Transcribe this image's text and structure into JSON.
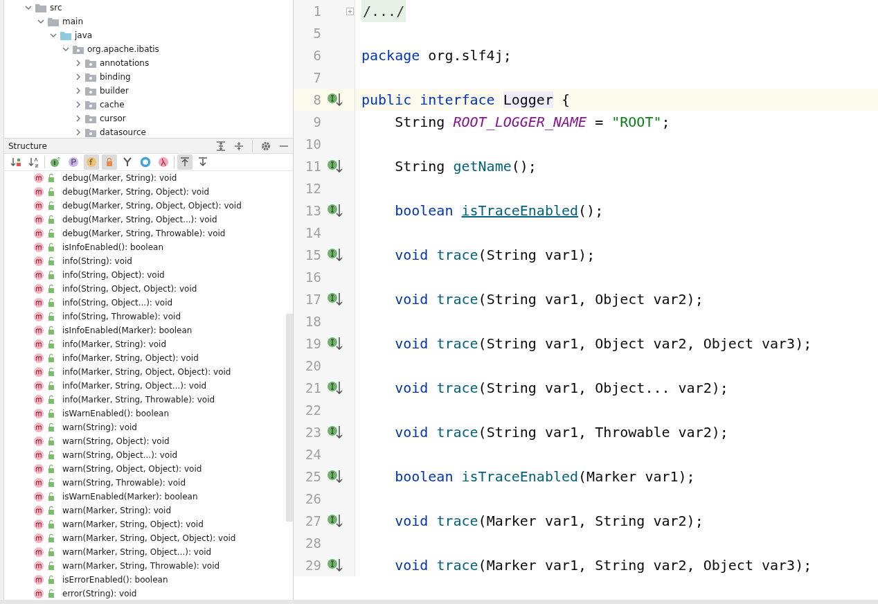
{
  "project_tree": [
    {
      "label": "src",
      "kind": "folder",
      "expanded": true,
      "children": [
        {
          "label": "main",
          "kind": "folder",
          "expanded": true,
          "children": [
            {
              "label": "java",
              "kind": "source",
              "expanded": true,
              "children": [
                {
                  "label": "org.apache.ibatis",
                  "kind": "package",
                  "expanded": true,
                  "children": [
                    {
                      "label": "annotations",
                      "kind": "package",
                      "expanded": false
                    },
                    {
                      "label": "binding",
                      "kind": "package",
                      "expanded": false
                    },
                    {
                      "label": "builder",
                      "kind": "package",
                      "expanded": false
                    },
                    {
                      "label": "cache",
                      "kind": "package",
                      "expanded": false
                    },
                    {
                      "label": "cursor",
                      "kind": "package",
                      "expanded": false
                    },
                    {
                      "label": "datasource",
                      "kind": "package",
                      "expanded": false
                    }
                  ]
                }
              ]
            }
          ]
        }
      ]
    }
  ],
  "structure": {
    "title": "Structure",
    "toolbar": [
      {
        "kind": "sort-visibility",
        "selected": false
      },
      {
        "kind": "sort-alpha",
        "selected": false
      },
      {
        "kind": "interface",
        "selected": false
      },
      {
        "kind": "property",
        "selected": false
      },
      {
        "kind": "field",
        "selected": true
      },
      {
        "kind": "lock",
        "selected": true
      },
      {
        "kind": "fork",
        "selected": false
      },
      {
        "kind": "ring",
        "selected": false
      },
      {
        "kind": "lambda",
        "selected": false
      },
      {
        "kind": "autoscroll-to",
        "selected": true
      },
      {
        "kind": "autoscroll-from",
        "selected": false
      }
    ],
    "members": [
      "debug(Marker, String): void",
      "debug(Marker, String, Object): void",
      "debug(Marker, String, Object, Object): void",
      "debug(Marker, String, Object...): void",
      "debug(Marker, String, Throwable): void",
      "isInfoEnabled(): boolean",
      "info(String): void",
      "info(String, Object): void",
      "info(String, Object, Object): void",
      "info(String, Object...): void",
      "info(String, Throwable): void",
      "isInfoEnabled(Marker): boolean",
      "info(Marker, String): void",
      "info(Marker, String, Object): void",
      "info(Marker, String, Object, Object): void",
      "info(Marker, String, Object...): void",
      "info(Marker, String, Throwable): void",
      "isWarnEnabled(): boolean",
      "warn(String): void",
      "warn(String, Object): void",
      "warn(String, Object...): void",
      "warn(String, Object, Object): void",
      "warn(String, Throwable): void",
      "isWarnEnabled(Marker): boolean",
      "warn(Marker, String): void",
      "warn(Marker, String, Object): void",
      "warn(Marker, String, Object, Object): void",
      "warn(Marker, String, Object...): void",
      "warn(Marker, String, Throwable): void",
      "isErrorEnabled(): boolean",
      "error(String): void"
    ]
  },
  "editor": {
    "lines": [
      {
        "number": "1",
        "fold": true,
        "implements": false,
        "current": false,
        "tokens": [
          {
            "text": "/.../",
            "kind": "folded"
          }
        ]
      },
      {
        "number": "5",
        "fold": false,
        "implements": false,
        "current": false
      },
      {
        "number": "6",
        "fold": false,
        "implements": false,
        "current": false,
        "tokens": [
          {
            "text": "package ",
            "kind": "kw"
          },
          {
            "text": "org.slf4j;",
            "kind": "plain"
          }
        ]
      },
      {
        "number": "7",
        "fold": false,
        "implements": false,
        "current": false
      },
      {
        "number": "8",
        "fold": false,
        "implements": true,
        "current": true,
        "tokens": [
          {
            "text": "public interface ",
            "kind": "kw"
          },
          {
            "text": "Logger",
            "kind": "highlight"
          },
          {
            "text": " {",
            "kind": "plain"
          }
        ]
      },
      {
        "number": "9",
        "fold": false,
        "implements": false,
        "current": false,
        "tokens": [
          {
            "text": "    String ",
            "kind": "plain"
          },
          {
            "text": "ROOT_LOGGER_NAME",
            "kind": "const"
          },
          {
            "text": " = ",
            "kind": "plain"
          },
          {
            "text": "\"ROOT\"",
            "kind": "str"
          },
          {
            "text": ";",
            "kind": "plain"
          }
        ]
      },
      {
        "number": "10",
        "fold": false,
        "implements": false,
        "current": false
      },
      {
        "number": "11",
        "fold": false,
        "implements": true,
        "current": false,
        "tokens": [
          {
            "text": "    String ",
            "kind": "plain"
          },
          {
            "text": "getName",
            "kind": "fn"
          },
          {
            "text": "();",
            "kind": "plain"
          }
        ]
      },
      {
        "number": "12",
        "fold": false,
        "implements": false,
        "current": false
      },
      {
        "number": "13",
        "fold": false,
        "implements": true,
        "current": false,
        "tokens": [
          {
            "text": "    boolean ",
            "kind": "kw"
          },
          {
            "text": "isTraceEnabled",
            "kind": "link"
          },
          {
            "text": "();",
            "kind": "plain"
          }
        ]
      },
      {
        "number": "14",
        "fold": false,
        "implements": false,
        "current": false
      },
      {
        "number": "15",
        "fold": false,
        "implements": true,
        "current": false,
        "tokens": [
          {
            "text": "    void ",
            "kind": "kw"
          },
          {
            "text": "trace",
            "kind": "fn"
          },
          {
            "text": "(String var1);",
            "kind": "plain"
          }
        ]
      },
      {
        "number": "16",
        "fold": false,
        "implements": false,
        "current": false
      },
      {
        "number": "17",
        "fold": false,
        "implements": true,
        "current": false,
        "tokens": [
          {
            "text": "    void ",
            "kind": "kw"
          },
          {
            "text": "trace",
            "kind": "fn"
          },
          {
            "text": "(String var1, Object var2);",
            "kind": "plain"
          }
        ]
      },
      {
        "number": "18",
        "fold": false,
        "implements": false,
        "current": false
      },
      {
        "number": "19",
        "fold": false,
        "implements": true,
        "current": false,
        "tokens": [
          {
            "text": "    void ",
            "kind": "kw"
          },
          {
            "text": "trace",
            "kind": "fn"
          },
          {
            "text": "(String var1, Object var2, Object var3);",
            "kind": "plain"
          }
        ]
      },
      {
        "number": "20",
        "fold": false,
        "implements": false,
        "current": false
      },
      {
        "number": "21",
        "fold": false,
        "implements": true,
        "current": false,
        "tokens": [
          {
            "text": "    void ",
            "kind": "kw"
          },
          {
            "text": "trace",
            "kind": "fn"
          },
          {
            "text": "(String var1, Object... var2);",
            "kind": "plain"
          }
        ]
      },
      {
        "number": "22",
        "fold": false,
        "implements": false,
        "current": false
      },
      {
        "number": "23",
        "fold": false,
        "implements": true,
        "current": false,
        "tokens": [
          {
            "text": "    void ",
            "kind": "kw"
          },
          {
            "text": "trace",
            "kind": "fn"
          },
          {
            "text": "(String var1, Throwable var2);",
            "kind": "plain"
          }
        ]
      },
      {
        "number": "24",
        "fold": false,
        "implements": false,
        "current": false
      },
      {
        "number": "25",
        "fold": false,
        "implements": true,
        "current": false,
        "tokens": [
          {
            "text": "    boolean ",
            "kind": "kw"
          },
          {
            "text": "isTraceEnabled",
            "kind": "fn"
          },
          {
            "text": "(Marker var1);",
            "kind": "plain"
          }
        ]
      },
      {
        "number": "26",
        "fold": false,
        "implements": false,
        "current": false
      },
      {
        "number": "27",
        "fold": false,
        "implements": true,
        "current": false,
        "tokens": [
          {
            "text": "    void ",
            "kind": "kw"
          },
          {
            "text": "trace",
            "kind": "fn"
          },
          {
            "text": "(Marker var1, String var2);",
            "kind": "plain"
          }
        ]
      },
      {
        "number": "28",
        "fold": false,
        "implements": false,
        "current": false
      },
      {
        "number": "29",
        "fold": false,
        "implements": true,
        "current": false,
        "tokens": [
          {
            "text": "    void ",
            "kind": "kw"
          },
          {
            "text": "trace",
            "kind": "fn"
          },
          {
            "text": "(Marker var1, String var2, Object var3);",
            "kind": "plain"
          }
        ]
      }
    ]
  }
}
